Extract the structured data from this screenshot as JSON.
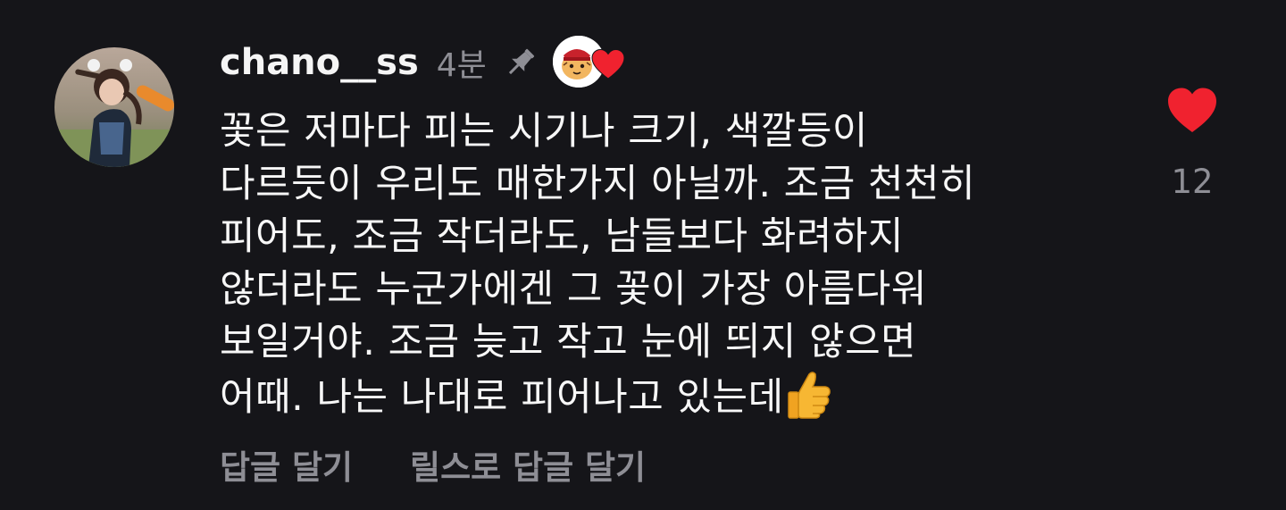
{
  "comment": {
    "username": "chano__ss",
    "time": "4분",
    "text_lines": [
      "꽃은 저마다 피는 시기나 크기, 색깔등이",
      "다르듯이 우리도 매한가지 아닐까. 조금 천천히",
      "피어도, 조금 작더라도, 남들보다 화려하지",
      "않더라도 누군가에겐 그 꽃이 가장 아름다워",
      "보일거야. 조금 늦고 작고 눈에 띄지 않으면",
      "어때. 나는 나대로 피어나고 있는데"
    ],
    "trailing_emoji": "thumbs-up-emoji",
    "like_count": "12",
    "liked": true
  },
  "actions": {
    "reply_label": "답글 달기",
    "reels_reply_label": "릴스로 답글 달기"
  },
  "icons": {
    "pin": "pin-icon",
    "creator_liked": "creator-liked-heart-icon",
    "like": "heart-icon"
  },
  "colors": {
    "background": "#151519",
    "text": "#f7f7f7",
    "muted": "#8e8e95",
    "heart": "#f0222f"
  }
}
